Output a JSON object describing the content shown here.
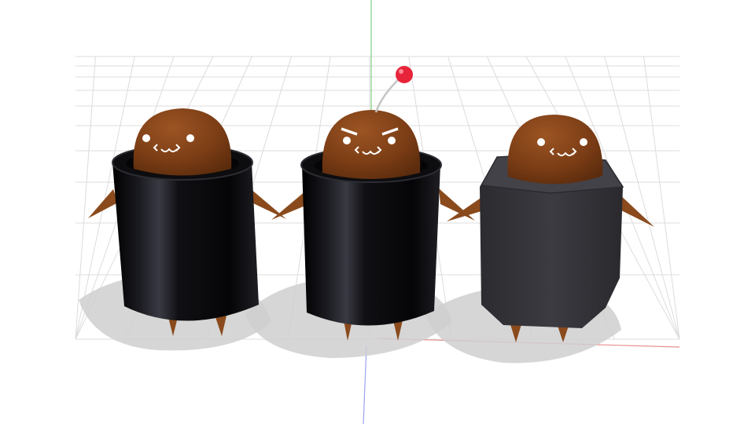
{
  "viewport": {
    "background": "#ffffff",
    "grid_color": "#dcdcdc",
    "axis_colors": {
      "y": "#7fd07f",
      "x": "#e88f8f",
      "z": "#9aa4ee"
    }
  },
  "characters": [
    {
      "id": "left",
      "face": "smile",
      "cup_shape": "cylinder",
      "cup_color": "#0b0b0e",
      "has_antenna": false
    },
    {
      "id": "middle",
      "face": "angry",
      "cup_shape": "cylinder",
      "cup_color": "#0b0b0e",
      "has_antenna": true,
      "antenna_ball_color": "#e8243a"
    },
    {
      "id": "right",
      "face": "smile",
      "cup_shape": "octagonal",
      "cup_color": "#3a393e",
      "has_antenna": false
    }
  ],
  "colors": {
    "head": "#7b3d15",
    "head_highlight": "#a85b25",
    "limb": "#8a4a1c",
    "face_marks": "#ffffff",
    "shadow": "#cfcfcf"
  }
}
